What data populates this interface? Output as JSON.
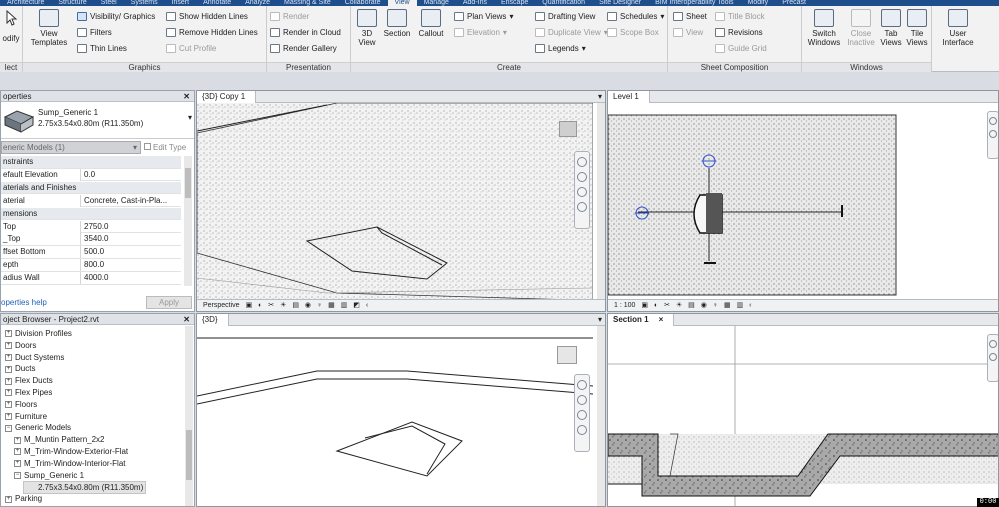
{
  "ribbon_tabs": [
    "Architecture",
    "Structure",
    "Steel",
    "Systems",
    "Insert",
    "Annotate",
    "Analyze",
    "Massing & Site",
    "Collaborate",
    "View",
    "Manage",
    "Add-Ins",
    "Enscape",
    "Quantification",
    "Site Designer",
    "BIM Interoperability Tools",
    "Modify",
    "Precast"
  ],
  "active_tab": "View",
  "ribbon": {
    "modify_label": "odify",
    "select_label": "lect",
    "view_templates_l1": "View",
    "view_templates_l2": "Templates",
    "visibility_graphics": "Visibility/ Graphics",
    "filters": "Filters",
    "thin_lines": "Thin Lines",
    "show_hidden_lines": "Show Hidden Lines",
    "remove_hidden_lines": "Remove Hidden Lines",
    "cut_profile": "Cut Profile",
    "graphics_label": "Graphics",
    "render": "Render",
    "render_in_cloud": "Render in Cloud",
    "render_gallery": "Render Gallery",
    "presentation_label": "Presentation",
    "view_3d_l1": "3D",
    "view_3d_l2": "View",
    "section": "Section",
    "callout": "Callout",
    "plan_views": "Plan Views",
    "elevation": "Elevation",
    "drafting_view": "Drafting View",
    "duplicate_view": "Duplicate View",
    "legends": "Legends",
    "schedules": "Schedules",
    "scope_box": "Scope Box",
    "create_label": "Create",
    "sheet": "Sheet",
    "view": "View",
    "title_block": "Title Block",
    "revisions": "Revisions",
    "guide_grid": "Guide Grid",
    "sheet_composition_label": "Sheet Composition",
    "switch_windows_l1": "Switch",
    "switch_windows_l2": "Windows",
    "close_inactive_l1": "Close",
    "close_inactive_l2": "Inactive",
    "tab_views_l1": "Tab",
    "tab_views_l2": "Views",
    "tile_views_l1": "Tile",
    "tile_views_l2": "Views",
    "windows_label": "Windows",
    "user_interface_l1": "User",
    "user_interface_l2": "Interface"
  },
  "properties": {
    "title": "operties",
    "family_name": "Sump_Generic 1",
    "family_type": "2.75x3.54x0.80m (R11.350m)",
    "category": "eneric Models (1)",
    "edit_type": "Edit Type",
    "rows": [
      {
        "cat": true,
        "name": "nstraints"
      },
      {
        "name": "efault Elevation",
        "value": "0.0"
      },
      {
        "cat": true,
        "name": "aterials and Finishes"
      },
      {
        "name": "aterial",
        "value": "Concrete, Cast-in-Pla..."
      },
      {
        "cat": true,
        "name": "mensions"
      },
      {
        "name": "Top",
        "value": "2750.0"
      },
      {
        "name": "_Top",
        "value": "3540.0"
      },
      {
        "name": "ffset Bottom",
        "value": "500.0"
      },
      {
        "name": "epth",
        "value": "800.0"
      },
      {
        "name": "adius Wall",
        "value": "4000.0"
      }
    ],
    "help": "operties help",
    "apply": "Apply"
  },
  "project_browser": {
    "title": "oject Browser - Project2.rvt",
    "items": [
      {
        "label": "Division Profiles",
        "level": 1,
        "sym": "+"
      },
      {
        "label": "Doors",
        "level": 1,
        "sym": "+"
      },
      {
        "label": "Duct Systems",
        "level": 1,
        "sym": "+"
      },
      {
        "label": "Ducts",
        "level": 1,
        "sym": "+"
      },
      {
        "label": "Flex Ducts",
        "level": 1,
        "sym": "+"
      },
      {
        "label": "Flex Pipes",
        "level": 1,
        "sym": "+"
      },
      {
        "label": "Floors",
        "level": 1,
        "sym": "+"
      },
      {
        "label": "Furniture",
        "level": 1,
        "sym": "+"
      },
      {
        "label": "Generic Models",
        "level": 1,
        "sym": "−"
      },
      {
        "label": "M_Muntin Pattern_2x2",
        "level": 2,
        "sym": "+"
      },
      {
        "label": "M_Trim-Window-Exterior-Flat",
        "level": 2,
        "sym": "+"
      },
      {
        "label": "M_Trim-Window-Interior-Flat",
        "level": 2,
        "sym": "+"
      },
      {
        "label": "Sump_Generic 1",
        "level": 2,
        "sym": "−"
      },
      {
        "label": "2.75x3.54x0.80m (R11.350m)",
        "level": 3,
        "sym": "",
        "selected": true
      },
      {
        "label": "Parking",
        "level": 1,
        "sym": "+"
      }
    ]
  },
  "views": {
    "v1": {
      "tab": "{3D} Copy 1",
      "bar": "Perspective"
    },
    "v2": {
      "tab": "Level 1",
      "bar": "1 : 100"
    },
    "v3": {
      "tab": "{3D}"
    },
    "v4": {
      "tab": "Section 1",
      "close": "×"
    }
  },
  "timer": "0:00",
  "colors": {
    "accent": "#1f4e8c",
    "ribbon_bg": "#f2f2f2",
    "section_fill": "#a9a9a9"
  }
}
